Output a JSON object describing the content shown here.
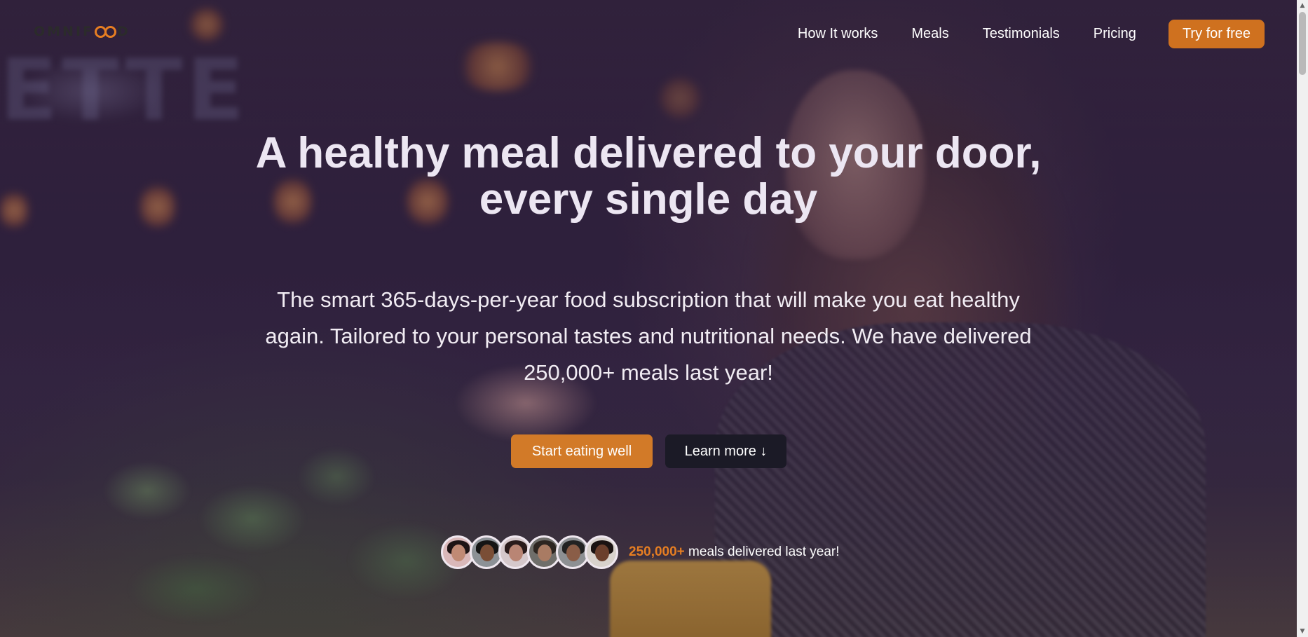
{
  "header": {
    "logo_text_left": "OMNIF",
    "logo_text_right": "D",
    "nav": [
      {
        "label": "How It works"
      },
      {
        "label": "Meals"
      },
      {
        "label": "Testimonials"
      },
      {
        "label": "Pricing"
      }
    ],
    "cta_label": "Try for free"
  },
  "hero": {
    "title": "A healthy meal delivered to your door, every single day",
    "description": "The smart 365-days-per-year food subscription that will make you eat healthy again. Tailored to your personal tastes and nutritional needs. We have delivered 250,000+ meals last year!",
    "primary_button": "Start eating well",
    "secondary_button": "Learn more ↓",
    "proof_highlight": "250,000+",
    "proof_text": " meals delivered last year!"
  },
  "colors": {
    "accent": "#e67e22",
    "button_primary": "#d27a28",
    "button_secondary": "#1b1a26"
  }
}
